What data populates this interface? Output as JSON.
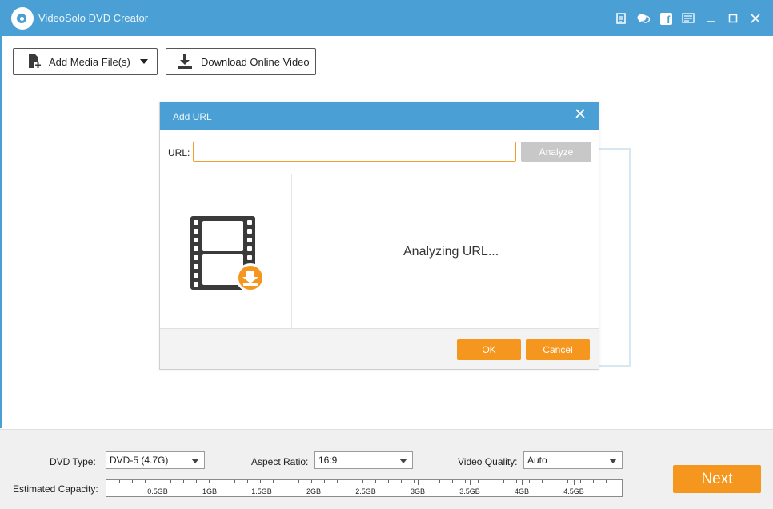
{
  "app": {
    "title": "VideoSolo DVD Creator"
  },
  "titlebar_icons": [
    "register-icon",
    "feedback-icon",
    "facebook-icon",
    "menu-icon",
    "minimize-icon",
    "maximize-icon",
    "close-icon"
  ],
  "toolbar": {
    "add_media_label": "Add Media File(s)",
    "download_label": "Download Online Video"
  },
  "dialog": {
    "title": "Add URL",
    "url_label": "URL:",
    "url_value": "",
    "analyze_label": "Analyze",
    "status_text": "Analyzing URL...",
    "ok_label": "OK",
    "cancel_label": "Cancel"
  },
  "bottom": {
    "dvd_type_label": "DVD Type:",
    "dvd_type_value": "DVD-5 (4.7G)",
    "aspect_ratio_label": "Aspect Ratio:",
    "aspect_ratio_value": "16:9",
    "video_quality_label": "Video Quality:",
    "video_quality_value": "Auto",
    "capacity_label": "Estimated Capacity:",
    "capacity_ticks": [
      "0.5GB",
      "1GB",
      "1.5GB",
      "2GB",
      "2.5GB",
      "3GB",
      "3.5GB",
      "4GB",
      "4.5GB"
    ],
    "next_label": "Next"
  },
  "colors": {
    "titlebar": "#4aa0d4",
    "accent_orange": "#f5961e",
    "analyze_disabled": "#c8c8c8"
  }
}
